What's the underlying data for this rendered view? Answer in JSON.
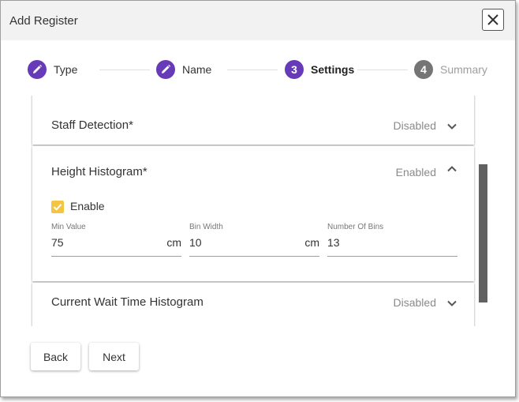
{
  "dialog": {
    "title": "Add Register"
  },
  "stepper": {
    "steps": [
      {
        "label": "Type",
        "state": "edit",
        "icon": "pencil-icon"
      },
      {
        "label": "Name",
        "state": "edit",
        "icon": "pencil-icon"
      },
      {
        "label": "Settings",
        "number": "3",
        "state": "active"
      },
      {
        "label": "Summary",
        "number": "4",
        "state": "inactive"
      }
    ]
  },
  "panels": {
    "staff_detection": {
      "title": "Staff Detection*",
      "status": "Disabled",
      "expanded": false
    },
    "height_histogram": {
      "title": "Height Histogram*",
      "status": "Enabled",
      "expanded": true,
      "enable_label": "Enable",
      "enabled": true,
      "fields": {
        "min_value": {
          "label": "Min Value",
          "value": "75",
          "unit": "cm"
        },
        "bin_width": {
          "label": "Bin Width",
          "value": "10",
          "unit": "cm"
        },
        "number_of_bins": {
          "label": "Number Of Bins",
          "value": "13"
        }
      }
    },
    "current_wait_time": {
      "title": "Current Wait Time Histogram",
      "status": "Disabled",
      "expanded": false
    }
  },
  "footer": {
    "back_label": "Back",
    "next_label": "Next"
  },
  "colors": {
    "accent": "#673ab7",
    "inactive_step": "#757575",
    "checkbox": "#f4c542"
  }
}
